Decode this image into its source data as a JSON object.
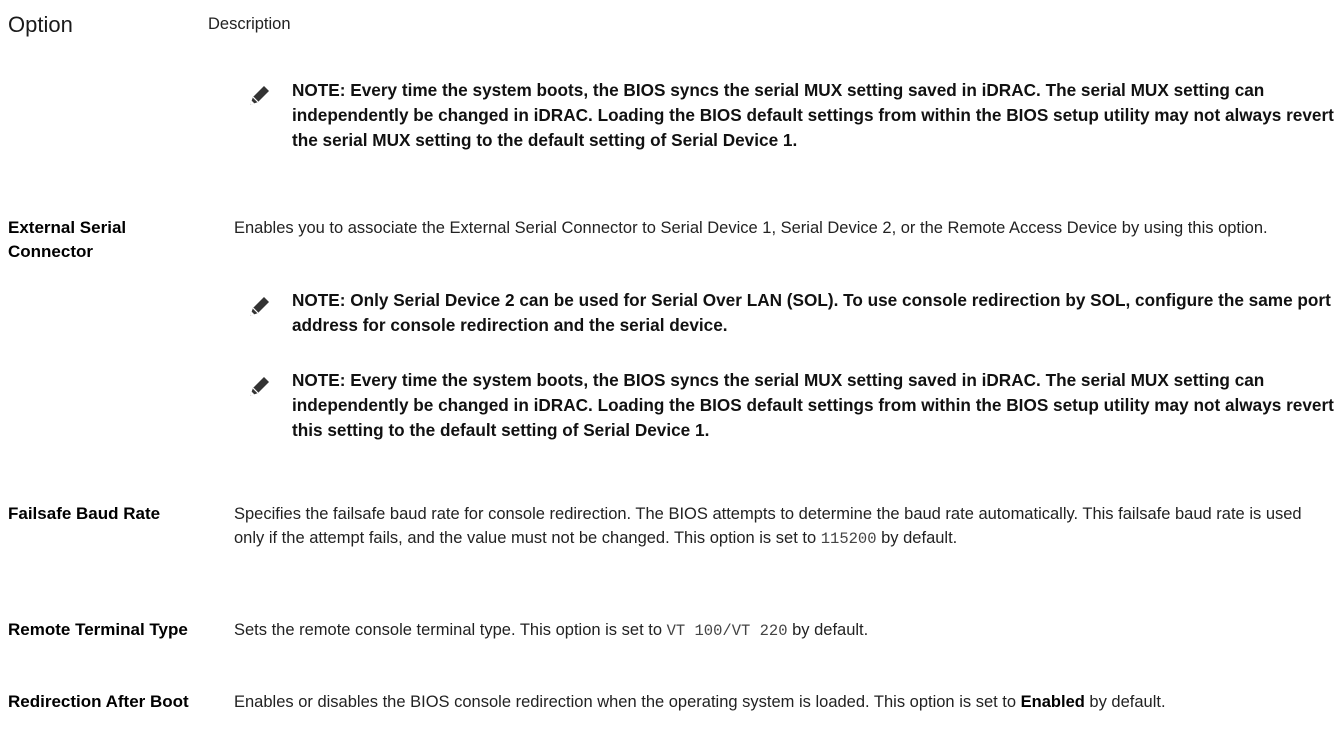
{
  "header": {
    "option": "Option",
    "description": "Description"
  },
  "notes": {
    "mux_device1": "NOTE: Every time the system boots, the BIOS syncs the serial MUX setting saved in iDRAC. The serial MUX setting can independently be changed in iDRAC. Loading the BIOS default settings from within the BIOS setup utility may not always revert the serial MUX setting to the default setting of Serial Device 1.",
    "sol": "NOTE: Only Serial Device 2 can be used for Serial Over LAN (SOL). To use console redirection by SOL, configure the same port address for console redirection and the serial device.",
    "mux_revert": "NOTE: Every time the system boots, the BIOS syncs the serial MUX setting saved in iDRAC. The serial MUX setting can independently be changed in iDRAC. Loading the BIOS default settings from within the BIOS setup utility may not always revert this setting to the default setting of Serial Device 1."
  },
  "rows": {
    "external_serial": {
      "label": "External Serial Connector",
      "description": "Enables you to associate the External Serial Connector to Serial Device 1, Serial Device 2, or the Remote Access Device by using this option."
    },
    "failsafe": {
      "label": "Failsafe Baud Rate",
      "description_pre": "Specifies the failsafe baud rate for console redirection. The BIOS attempts to determine the baud rate automatically. This failsafe baud rate is used only if the attempt fails, and the value must not be changed. This option is set to ",
      "value": "115200",
      "description_post": " by default."
    },
    "remote_terminal": {
      "label": "Remote Terminal Type",
      "description_pre": "Sets the remote console terminal type. This option is set to ",
      "value": "VT 100/VT 220",
      "description_post": " by default."
    },
    "redirection_after_boot": {
      "label": "Redirection After Boot",
      "description_pre": "Enables or disables the BIOS console redirection when the operating system is loaded. This option is set to ",
      "value": "Enabled",
      "description_post": " by default."
    }
  },
  "icons": {
    "note": "pencil-note-icon"
  }
}
